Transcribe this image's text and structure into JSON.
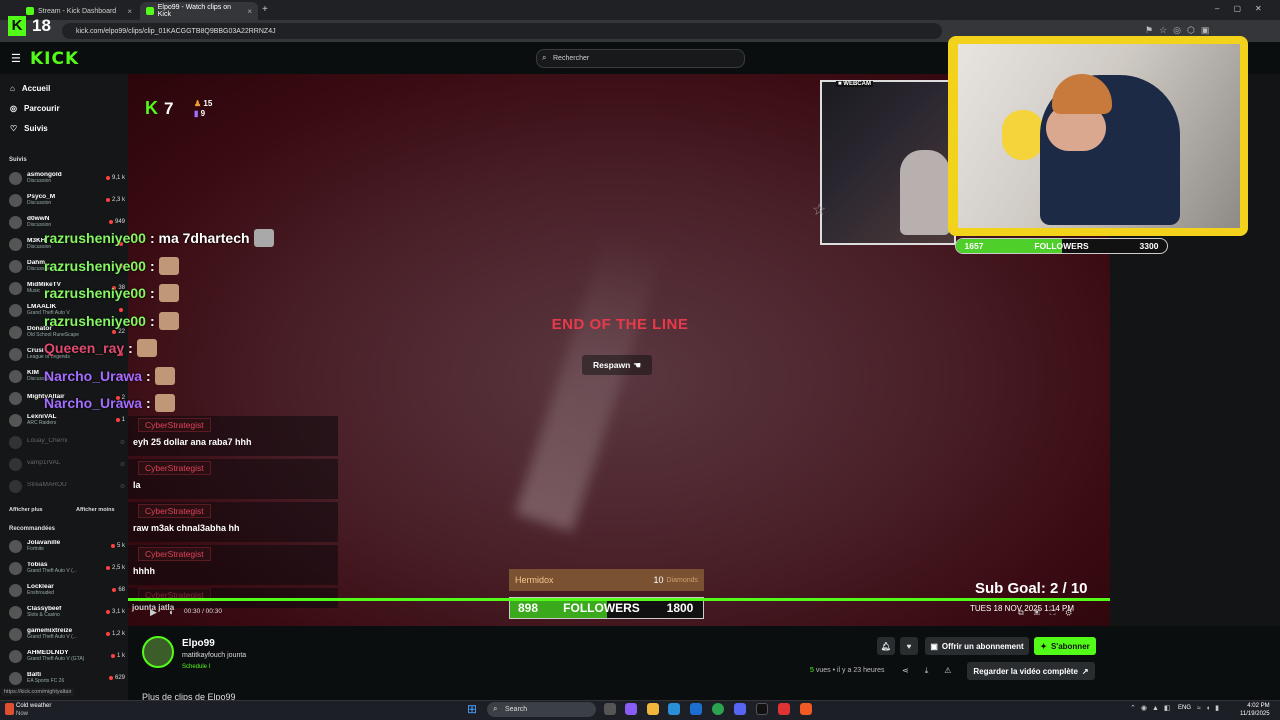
{
  "browser": {
    "tabs": [
      {
        "label": "Stream - Kick Dashboard"
      },
      {
        "label": "Elpo99 - Watch clips on Kick"
      }
    ],
    "url": "kick.com/elpo99/clips/clip_01KACGGTB8Q9BBG03A22RRNZ4J",
    "kick_tab_badge": "18"
  },
  "header": {
    "logo": "KICK",
    "search_placeholder": "Rechercher"
  },
  "sidebar": {
    "nav": [
      {
        "label": "Accueil",
        "icon": "home-icon"
      },
      {
        "label": "Parcourir",
        "icon": "compass-icon"
      },
      {
        "label": "Suivis",
        "icon": "heart-icon"
      }
    ],
    "followed_title": "Suivis",
    "followed": [
      {
        "name": "asmongold",
        "category": "Discussion",
        "viewers": "9,1 k",
        "live": true
      },
      {
        "name": "Psyco_M",
        "category": "Discussion",
        "viewers": "2,3 k",
        "live": true
      },
      {
        "name": "d0wwN",
        "category": "Discussion",
        "viewers": "949",
        "live": true
      },
      {
        "name": "M3KH",
        "category": "Discussion",
        "viewers": "",
        "live": true
      },
      {
        "name": "Dahm",
        "category": "Discussion",
        "viewers": "",
        "live": true
      },
      {
        "name": "MidMikeTV",
        "category": "Music",
        "viewers": "38",
        "live": true
      },
      {
        "name": "LMAALIK",
        "category": "Grand Theft Auto V",
        "viewers": "",
        "live": true
      },
      {
        "name": "Donator",
        "category": "Old School RuneScape",
        "viewers": "22",
        "live": true
      },
      {
        "name": "Crusi",
        "category": "League of Legends",
        "viewers": "",
        "live": true
      },
      {
        "name": "KIM",
        "category": "Discussion",
        "viewers": "",
        "live": true
      },
      {
        "name": "MightyAltair",
        "category": "",
        "viewers": "2",
        "live": true
      },
      {
        "name": "LexniVAL",
        "category": "ARC Raiders",
        "viewers": "1",
        "live": true
      },
      {
        "name": "Louay_Cherni",
        "category": "",
        "viewers": "",
        "live": false
      },
      {
        "name": "vamp1rVAL",
        "category": "",
        "viewers": "",
        "live": false
      },
      {
        "name": "StreaMAROU",
        "category": "",
        "viewers": "",
        "live": false
      }
    ],
    "show_more": "Afficher plus",
    "show_less": "Afficher moins",
    "recommended_title": "Recommandées",
    "recommended": [
      {
        "name": "Jolavanille",
        "category": "Fortnite",
        "viewers": "5 k"
      },
      {
        "name": "Tobias",
        "category": "Grand Theft Auto V (...",
        "viewers": "2,5 k"
      },
      {
        "name": "Locklear",
        "category": "Enshrouded",
        "viewers": "68"
      },
      {
        "name": "Classybeef",
        "category": "Slots & Casino",
        "viewers": "3,1 k"
      },
      {
        "name": "gamemixtreize",
        "category": "Grand Theft Auto V (...",
        "viewers": "1,2 k"
      },
      {
        "name": "AHMEDLNDY",
        "category": "Grand Theft Auto V (GTA)",
        "viewers": "1 k"
      },
      {
        "name": "Balti",
        "category": "EA Sports FC 26",
        "viewers": "629"
      }
    ],
    "status_url": "https://kick.com/mightyaltair"
  },
  "video": {
    "k_count": "7",
    "stat_top": "15",
    "stat_bottom": "9",
    "end_title": "END OF THE LINE",
    "respawn": "Respawn",
    "webcam_label": "WEBCAM",
    "followers_small": {
      "current": "1657",
      "label": "FOLLOWERS",
      "goal": "3300",
      "progress": 0.5
    },
    "donation": {
      "name": "Hermidox",
      "amount": "10",
      "unit": "Diamonds"
    },
    "followers_big": {
      "current": "898",
      "label": "FOLLOWERS",
      "goal": "1800",
      "progress": 0.5
    },
    "sub_goal": "Sub Goal:  2 / 10",
    "datetime": "TUES 18 NOV 2025 1:14 PM",
    "time": "00:30 / 00:30",
    "chat_overlay": [
      {
        "user": "razrusheniye00",
        "message": ": ma 7dhartech",
        "emote": "cat"
      },
      {
        "user": "razrusheniye00",
        "message": ":",
        "emote": "face"
      },
      {
        "user": "razrusheniye00",
        "message": ":",
        "emote": "face"
      },
      {
        "user": "razrusheniye00",
        "message": ":",
        "emote": "face"
      },
      {
        "user": "Queeen_ray",
        "message": ":",
        "emote": "face"
      },
      {
        "user": "Narcho_Urawa",
        "message": ":",
        "emote": "face"
      },
      {
        "user": "Narcho_Urawa",
        "message": ":",
        "emote": "face"
      }
    ],
    "chat_stream": [
      {
        "user": "CyberStrategist",
        "message": "eyh 25 dollar ana raba7 hhh"
      },
      {
        "user": "CyberStrategist",
        "message": "la"
      },
      {
        "user": "CyberStrategist",
        "message": "raw m3ak chnal3abha hh"
      },
      {
        "user": "CyberStrategist",
        "message": "hhhh"
      },
      {
        "user": "CyberStrategist",
        "message": "jounta jatla"
      }
    ]
  },
  "clip": {
    "channel": "Elpo99",
    "title": "matitkayfouch jounta",
    "schedule": "Schedule I",
    "views_count": "5",
    "views_label": "vues",
    "age": "il y a 23 heures",
    "offer_sub": "Offrir un abonnement",
    "subscribe": "S'abonner",
    "watch_full": "Regarder la vidéo complète",
    "more_clips": "Plus de clips de Elpo99"
  },
  "taskbar": {
    "weather_title": "Cold weather",
    "weather_sub": "Now",
    "search": "Search",
    "lang": "ENG",
    "time": "4:02 PM",
    "date": "11/19/2025"
  },
  "colors": {
    "brand": "#53fc18",
    "alert": "#e83a4a"
  }
}
